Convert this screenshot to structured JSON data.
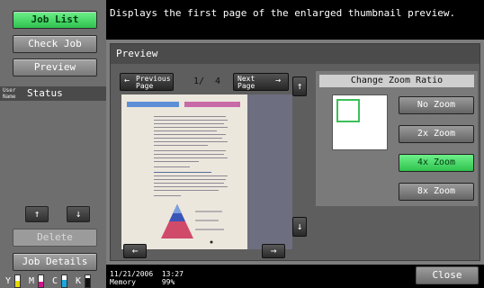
{
  "left_panel": {
    "job_list_label": "Job List",
    "check_job_label": "Check Job",
    "preview_label": "Preview",
    "status_user_label": "User Name",
    "status_label": "Status",
    "up_arrow": "↑",
    "down_arrow": "↓",
    "delete_label": "Delete",
    "job_details_label": "Job Details",
    "toner": [
      {
        "letter": "Y",
        "color": "#e6d800",
        "level": 0.55
      },
      {
        "letter": "M",
        "color": "#d1148a",
        "level": 0.45
      },
      {
        "letter": "C",
        "color": "#1aa7e0",
        "level": 0.6
      },
      {
        "letter": "K",
        "color": "#111111",
        "level": 0.75
      }
    ]
  },
  "message": "Displays the first page of the enlarged thumbnail preview.",
  "preview": {
    "title": "Preview",
    "previous_page_label": "Previous Page",
    "next_page_label": "Next Page",
    "current_page": "1/",
    "total_pages": "4",
    "arrow_up": "↑",
    "arrow_down": "↓",
    "arrow_left": "←",
    "arrow_right": "→"
  },
  "zoom": {
    "title": "Change Zoom Ratio",
    "options": [
      "No Zoom",
      "2x Zoom",
      "4x Zoom",
      "8x Zoom"
    ],
    "selected": "4x Zoom"
  },
  "bottom": {
    "date": "11/21/2006",
    "time": "13:27",
    "memory_label": "Memory",
    "memory_value": "99%",
    "close_label": "Close"
  },
  "colors": {
    "active_green": "#3fd861",
    "doc_header_blue": "#5c8fd6",
    "doc_header_pink": "#c86aa6"
  }
}
